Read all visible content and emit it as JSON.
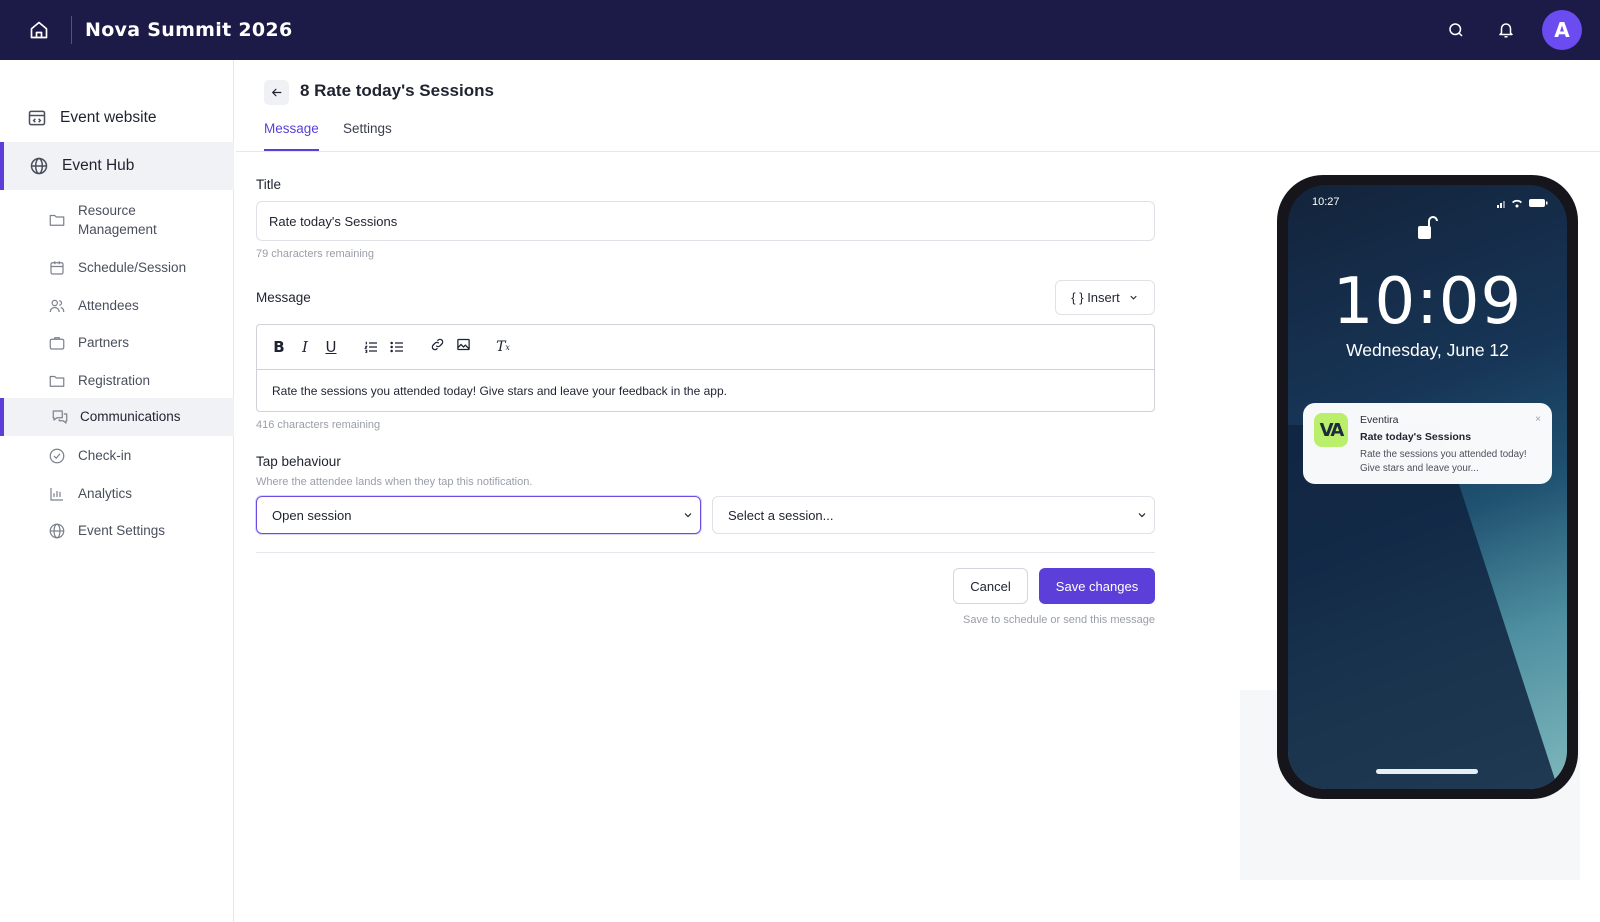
{
  "app": {
    "title": "Nova Summit 2026",
    "avatar_initial": "A",
    "accent_color": "#5b3fd8",
    "topbar_color": "#1c1b47"
  },
  "sidebar": {
    "top_items": [
      {
        "label": "Event website",
        "icon": "website-icon"
      },
      {
        "label": "Event Hub",
        "icon": "globe-icon",
        "active": true
      }
    ],
    "sub_items": [
      {
        "label_line1": "Resource",
        "label_line2": "Management",
        "icon": "folder-icon"
      },
      {
        "label": "Schedule/Session",
        "icon": "calendar-icon"
      },
      {
        "label": "Attendees",
        "icon": "users-icon"
      },
      {
        "label": "Partners",
        "icon": "briefcase-icon"
      },
      {
        "label": "Registration",
        "icon": "folder-icon"
      },
      {
        "label": "Communications",
        "icon": "chat-icon",
        "active": true
      },
      {
        "label": "Check-in",
        "icon": "check-circle-icon"
      },
      {
        "label": "Analytics",
        "icon": "bar-chart-icon"
      },
      {
        "label": "Event Settings",
        "icon": "globe-icon"
      }
    ]
  },
  "page": {
    "title": "8 Rate today's Sessions",
    "tabs": [
      {
        "label": "Message",
        "active": true
      },
      {
        "label": "Settings"
      }
    ]
  },
  "form": {
    "title_label": "Title",
    "title_value": "Rate today's Sessions",
    "title_remaining": "79 characters remaining",
    "message_label": "Message",
    "insert_label": "{ } Insert",
    "message_value": "Rate the sessions you attended today! Give stars and leave your feedback in the app.",
    "message_remaining": "416 characters remaining",
    "tap_label": "Tap behaviour",
    "tap_hint": "Where the attendee lands when they tap this notification.",
    "tap_action_value": "Open session",
    "session_placeholder": "Select a session...",
    "cancel_label": "Cancel",
    "save_label": "Save changes",
    "save_hint": "Save to schedule or send this message"
  },
  "phone": {
    "status_time": "10:27",
    "lock_time": "10:09",
    "lock_date": "Wednesday, June 12",
    "notification": {
      "app_name": "Eventira",
      "app_icon_text": "VA",
      "title": "Rate today's Sessions",
      "body": "Rate the sessions you attended today! Give stars and leave your...",
      "close": "×"
    }
  }
}
